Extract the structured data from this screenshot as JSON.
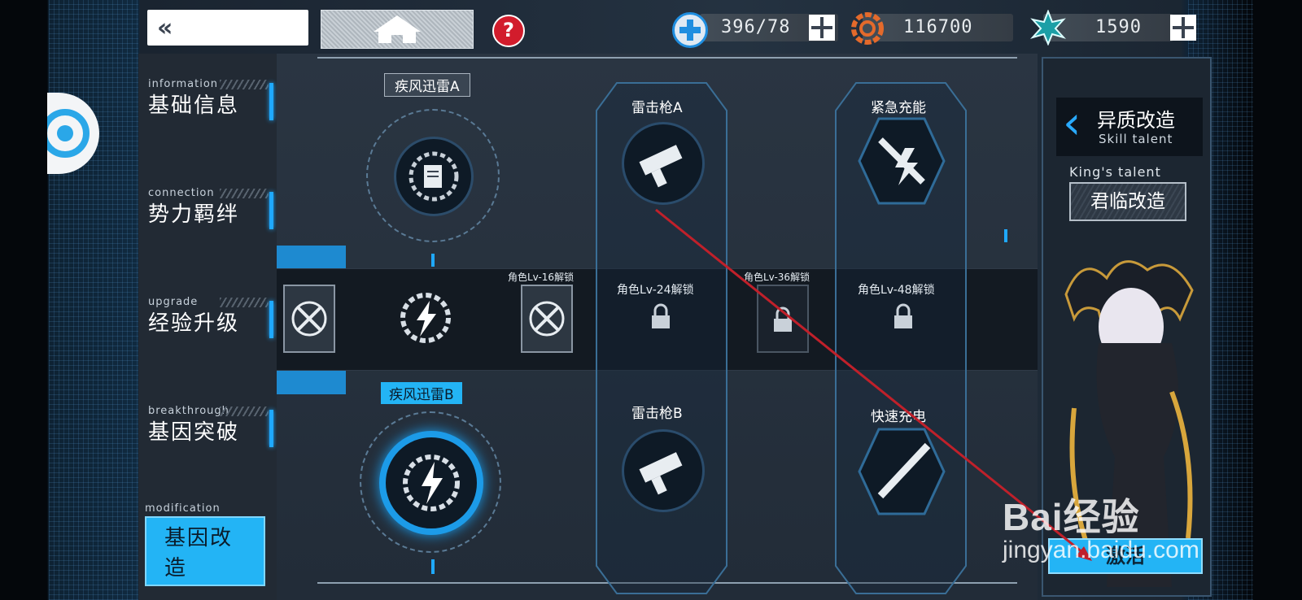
{
  "topbar": {
    "back_label": "«",
    "stamina": "396/78",
    "coins": "116700",
    "gems": "1590",
    "help_label": "?"
  },
  "nav": {
    "items": [
      {
        "en": "information",
        "cn": "基础信息"
      },
      {
        "en": "connection",
        "cn": "势力羁绊"
      },
      {
        "en": "upgrade",
        "cn": "经验升级"
      },
      {
        "en": "breakthrough",
        "cn": "基因突破"
      },
      {
        "en": "modification",
        "cn": "基因改造"
      }
    ]
  },
  "skills": {
    "top_left": "疾风迅雷A",
    "bottom_left": "疾风迅雷B",
    "top_mid": "雷击枪A",
    "bottom_mid": "雷击枪B",
    "top_right": "紧急充能",
    "bottom_right": "快速充电"
  },
  "unlocks": {
    "lv16": "角色Lv-16解锁",
    "lv24": "角色Lv-24解锁",
    "lv36": "角色Lv-36解锁",
    "lv48": "角色Lv-48解锁"
  },
  "panel": {
    "title_cn": "异质改造",
    "title_en": "Skill talent",
    "kings_talent": "King's talent",
    "kings_button": "君临改造",
    "action_button": "激活"
  },
  "watermark": {
    "line1": "Bai经验",
    "line2": "jingyan.baidu.com"
  },
  "colors": {
    "accent": "#23b4f5",
    "nav_bg": "#222a34",
    "arrow": "#c0202a"
  }
}
